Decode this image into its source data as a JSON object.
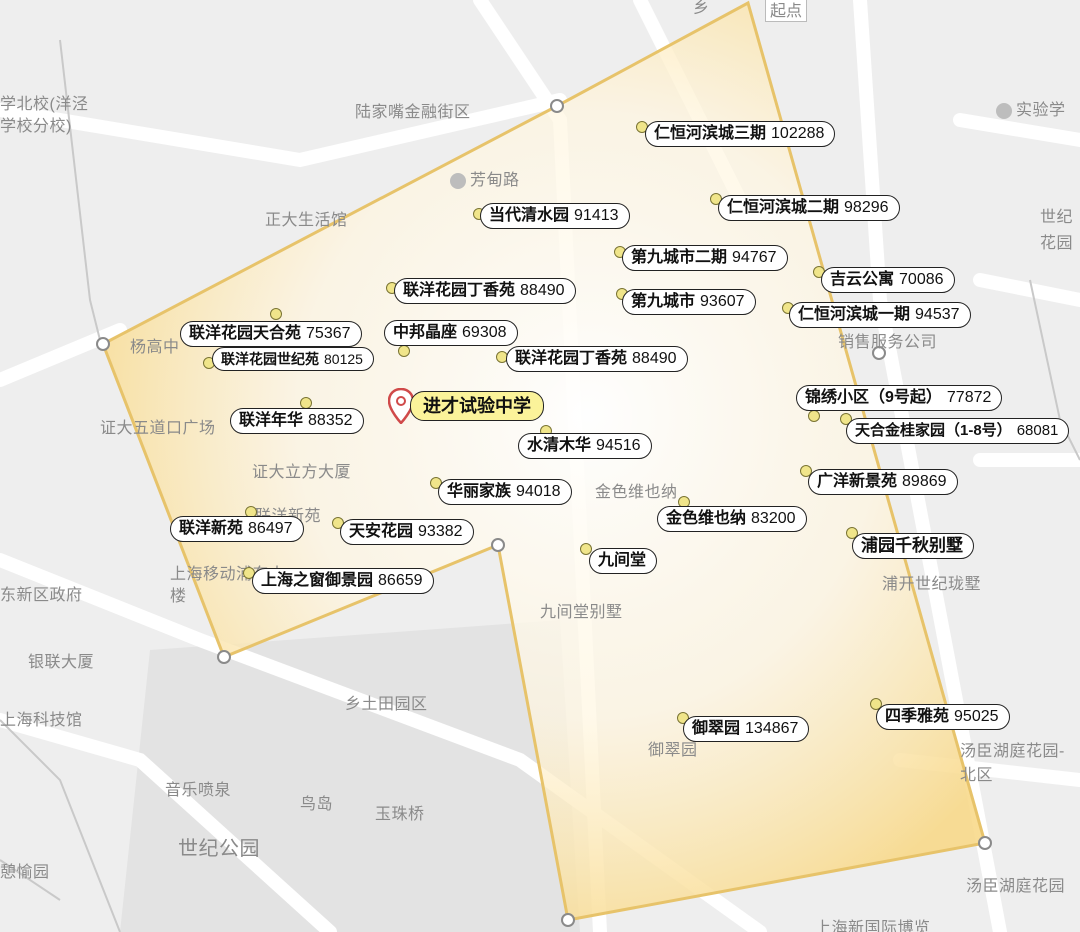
{
  "colors": {
    "polygon_fill": "#f8d98a",
    "polygon_stroke": "#e7c36a",
    "map_bg": "#eeeeee",
    "road": "#ffffff",
    "park": "#e2e2e2",
    "label_fill": "#ffffff",
    "school_fill": "#fbf39a",
    "pin_fill": "#f0e58a"
  },
  "school": {
    "name": "进才试验中学",
    "icon": "map-pin-icon"
  },
  "start_label": "起点",
  "poi_labels": [
    "陆家嘴金融街区",
    "芳甸路",
    "正大生活馆",
    "杨高中",
    "证大五道口广场",
    "证大立方大厦",
    "联洋新苑",
    "上海移动浦东大楼",
    "东新区政府",
    "银联大厦",
    "上海科技馆",
    "乡土田园区",
    "音乐喷泉",
    "鸟岛",
    "玉珠桥",
    "世纪公园",
    "憩愉园",
    "九间堂别墅",
    "金色维也纳",
    "销售服务公司",
    "浦开世纪珑墅",
    "汤臣湖庭花园-北区",
    "汤臣湖庭花园",
    "上海新国际博览",
    "实验学",
    "世纪花园",
    "学北校(洋泾",
    "学校分校)",
    "御翠园",
    "乡"
  ],
  "communities": [
    {
      "name": "仁恒河滨城三期",
      "price": "102288"
    },
    {
      "name": "仁恒河滨城二期",
      "price": "98296"
    },
    {
      "name": "当代清水园",
      "price": "91413"
    },
    {
      "name": "第九城市二期",
      "price": "94767"
    },
    {
      "name": "吉云公寓",
      "price": "70086"
    },
    {
      "name": "联洋花园丁香苑",
      "price": "88490"
    },
    {
      "name": "第九城市",
      "price": "93607"
    },
    {
      "name": "仁恒河滨城一期",
      "price": "94537"
    },
    {
      "name": "联洋花园天合苑",
      "price": "75367"
    },
    {
      "name": "中邦晶座",
      "price": "69308"
    },
    {
      "name": "联洋花园世纪苑",
      "price": "80125"
    },
    {
      "name": "联洋花园丁香苑",
      "price": "88490"
    },
    {
      "name": "锦绣小区（9号起）",
      "price": "77872"
    },
    {
      "name": "天合金桂家园（1-8号）",
      "price": "68081"
    },
    {
      "name": "联洋年华",
      "price": "88352"
    },
    {
      "name": "水清木华",
      "price": "94516"
    },
    {
      "name": "广洋新景苑",
      "price": "89869"
    },
    {
      "name": "华丽家族",
      "price": "94018"
    },
    {
      "name": "金色维也纳",
      "price": "83200"
    },
    {
      "name": "联洋新苑",
      "price": "86497"
    },
    {
      "name": "天安花园",
      "price": "93382"
    },
    {
      "name": "浦园千秋别墅",
      "price": ""
    },
    {
      "name": "九间堂",
      "price": ""
    },
    {
      "name": "上海之窗御景园",
      "price": "86659"
    },
    {
      "name": "四季雅苑",
      "price": "95025"
    },
    {
      "name": "御翠园",
      "price": "134867"
    }
  ]
}
